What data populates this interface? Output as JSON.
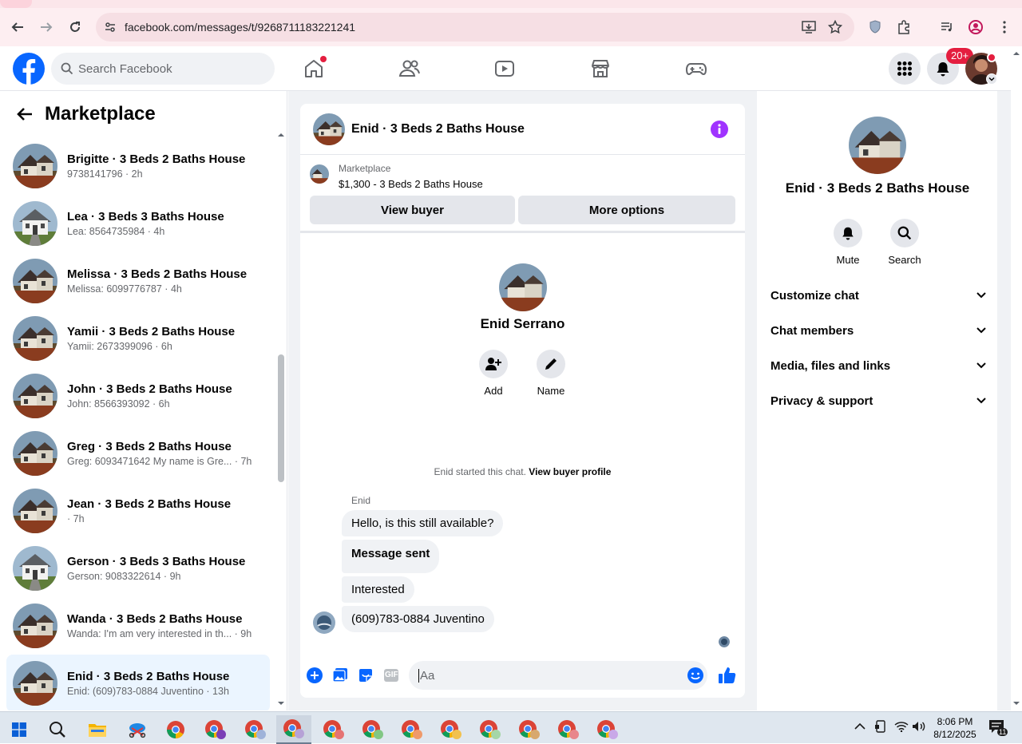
{
  "browser": {
    "url": "facebook.com/messages/t/9268711183221241"
  },
  "facebook": {
    "search_placeholder": "Search Facebook",
    "notification_badge": "20+"
  },
  "sidebar": {
    "title": "Marketplace",
    "conversations": [
      {
        "title": "Brigitte · 3 Beds 2 Baths House",
        "subtitle": "9738141796 · 2h",
        "thumb": "house-brown"
      },
      {
        "title": "Lea · 3 Beds 3 Baths House",
        "subtitle": "Lea: 8564735984 · 4h",
        "thumb": "house-white"
      },
      {
        "title": "Melissa · 3 Beds 2 Baths House",
        "subtitle": "Melissa: 6099776787 · 4h",
        "thumb": "house-brown"
      },
      {
        "title": "Yamii · 3 Beds 2 Baths House",
        "subtitle": "Yamii: 2673399096 · 6h",
        "thumb": "house-brown"
      },
      {
        "title": "John · 3 Beds 2 Baths House",
        "subtitle": "John: 8566393092 · 6h",
        "thumb": "house-brown"
      },
      {
        "title": "Greg · 3 Beds 2 Baths House",
        "subtitle": "Greg: 6093471642 My name is Gre... · 7h",
        "thumb": "house-brown"
      },
      {
        "title": "Jean · 3 Beds 2 Baths House",
        "subtitle": " · 7h",
        "thumb": "house-brown"
      },
      {
        "title": "Gerson · 3 Beds 3 Baths House",
        "subtitle": "Gerson: 9083322614 · 9h",
        "thumb": "house-white"
      },
      {
        "title": "Wanda · 3 Beds 2 Baths House",
        "subtitle": "Wanda: I'm am very interested in th... · 9h",
        "thumb": "house-brown"
      },
      {
        "title": "Enid · 3 Beds 2 Baths House",
        "subtitle": "Enid: (609)783-0884 Juventino · 13h",
        "thumb": "house-brown",
        "active": true
      }
    ]
  },
  "chat": {
    "header_title": "Enid · 3 Beds 2 Baths House",
    "marketplace_label": "Marketplace",
    "listing": "$1,300 - 3 Beds 2 Baths House",
    "view_buyer": "View buyer",
    "more_options": "More options",
    "profile_name": "Enid Serrano",
    "add_label": "Add",
    "name_label": "Name",
    "started_text": "Enid started this chat.",
    "view_buyer_profile": "View buyer profile",
    "sender_name": "Enid",
    "messages": [
      "Hello, is this still available?",
      "Message sent",
      "Interested",
      "(609)783-0884 Juventino"
    ],
    "composer_placeholder": "Aa",
    "gif_label": "GIF"
  },
  "details": {
    "title": "Enid · 3 Beds 2 Baths House",
    "mute_label": "Mute",
    "search_label": "Search",
    "sections": [
      "Customize chat",
      "Chat members",
      "Media, files and links",
      "Privacy & support"
    ]
  },
  "taskbar": {
    "time": "8:06 PM",
    "date": "8/12/2025",
    "notif_count": "11"
  },
  "colors": {
    "fb_blue": "#0866ff",
    "messenger_purple": "#a033ff",
    "active_row": "#ebf5ff",
    "badge_red": "#e41e3f"
  }
}
